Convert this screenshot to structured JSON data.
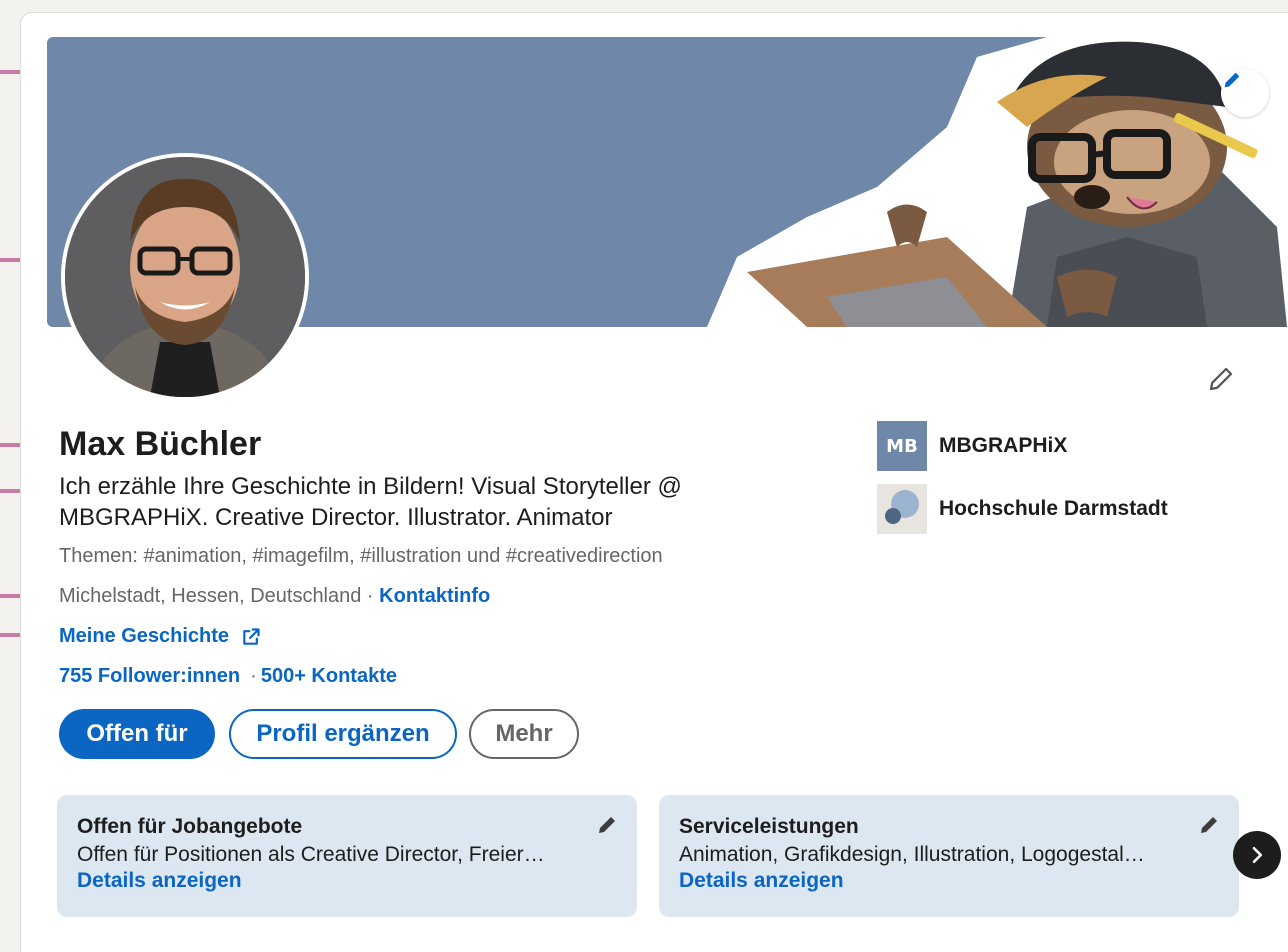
{
  "profile": {
    "name": "Max Büchler",
    "headline": "Ich erzähle Ihre Geschichte in Bildern! Visual Storyteller @ MBGRAPHiX. Creative Director. Illustrator. Animator",
    "themes": "Themen: #animation, #imagefilm, #illustration und #creativedirection",
    "location": "Michelstadt, Hessen, Deutschland",
    "location_sep": " · ",
    "contact_link": "Kontaktinfo",
    "website_link": "Meine Geschichte",
    "followers": "755 Follower:innen",
    "connections": "500+ Kontakte",
    "stats_sep": "·"
  },
  "actions": {
    "open_to": "Offen für",
    "complete_profile": "Profil ergänzen",
    "more": "Mehr"
  },
  "organizations": [
    {
      "name": "MBGRAPHiX",
      "logo_text": "MB"
    },
    {
      "name": "Hochschule Darmstadt"
    }
  ],
  "features": [
    {
      "title": "Offen für Jobangebote",
      "description": "Offen für Positionen als Creative Director, Freier…",
      "link": "Details anzeigen"
    },
    {
      "title": "Serviceleistungen",
      "description": "Animation, Grafikdesign, Illustration, Logogestal…",
      "link": "Details anzeigen"
    }
  ],
  "colors": {
    "brand_blue": "#0a66c2",
    "banner_blue": "#6f87a9",
    "annotation_pink": "#c97ba6",
    "feature_bg": "#dde7f1"
  },
  "icons": {
    "banner_edit": "pencil-icon",
    "profile_edit": "pencil-icon",
    "external_link": "external-link-icon",
    "carousel_next": "chevron-right-icon"
  }
}
